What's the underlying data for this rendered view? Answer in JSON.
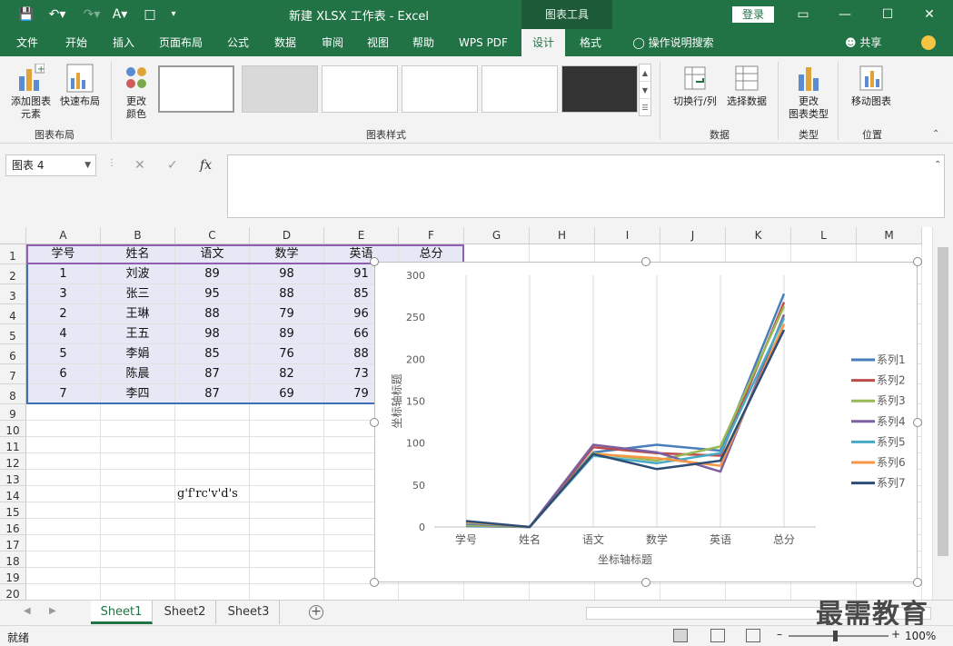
{
  "titlebar": {
    "title": "新建 XLSX 工作表 - Excel",
    "context_tab": "图表工具",
    "login": "登录"
  },
  "tabs": [
    "文件",
    "开始",
    "插入",
    "页面布局",
    "公式",
    "数据",
    "审阅",
    "视图",
    "帮助",
    "WPS PDF",
    "设计",
    "格式"
  ],
  "active_tab": "设计",
  "tell_me": "操作说明搜索",
  "share": "共享",
  "ribbon": {
    "layout_group": {
      "label": "图表布局",
      "add_element": "添加图表\n元素",
      "quick_layout": "快速布局"
    },
    "change_colors": "更改\n颜色",
    "styles_group_label": "图表样式",
    "data_group": {
      "label": "数据",
      "switch_row_col": "切换行/列",
      "select_data": "选择数据"
    },
    "type_group": {
      "label": "类型",
      "change_type": "更改\n图表类型"
    },
    "location_group": {
      "label": "位置",
      "move_chart": "移动图表"
    }
  },
  "formula_bar": {
    "name_box": "图表 4",
    "fx": "fx",
    "value": ""
  },
  "columns": [
    "A",
    "B",
    "C",
    "D",
    "E",
    "F",
    "G",
    "H",
    "I",
    "J",
    "K",
    "L",
    "M"
  ],
  "rows": [
    "1",
    "2",
    "3",
    "4",
    "5",
    "6",
    "7",
    "8",
    "9",
    "10",
    "11",
    "12",
    "13",
    "14",
    "15",
    "16",
    "17",
    "18",
    "19",
    "20"
  ],
  "table": {
    "headers": [
      "学号",
      "姓名",
      "语文",
      "数学",
      "英语",
      "总分"
    ],
    "rows": [
      [
        "1",
        "刘波",
        "89",
        "98",
        "91"
      ],
      [
        "3",
        "张三",
        "95",
        "88",
        "85"
      ],
      [
        "2",
        "王琳",
        "88",
        "79",
        "96"
      ],
      [
        "4",
        "王五",
        "98",
        "89",
        "66"
      ],
      [
        "5",
        "李娟",
        "85",
        "76",
        "88"
      ],
      [
        "6",
        "陈晨",
        "87",
        "82",
        "73"
      ],
      [
        "7",
        "李四",
        "87",
        "69",
        "79"
      ]
    ]
  },
  "stray_cell_text": "g'f'rc'v'd's",
  "chart_data": {
    "type": "line",
    "categories": [
      "学号",
      "姓名",
      "语文",
      "数学",
      "英语",
      "总分"
    ],
    "xlabel": "坐标轴标题",
    "ylabel": "坐标轴标题",
    "ylim": [
      0,
      300
    ],
    "yticks": [
      0,
      50,
      100,
      150,
      200,
      250,
      300
    ],
    "grid": "vertical category lines",
    "legend_position": "right",
    "series": [
      {
        "name": "系列1",
        "color": "#4a7ebb",
        "values": [
          1,
          0,
          89,
          98,
          91,
          278
        ]
      },
      {
        "name": "系列2",
        "color": "#be4b48",
        "values": [
          3,
          0,
          95,
          88,
          85,
          268
        ]
      },
      {
        "name": "系列3",
        "color": "#98b954",
        "values": [
          2,
          0,
          88,
          79,
          96,
          263
        ]
      },
      {
        "name": "系列4",
        "color": "#7d60a0",
        "values": [
          4,
          0,
          98,
          89,
          66,
          253
        ]
      },
      {
        "name": "系列5",
        "color": "#46aac5",
        "values": [
          5,
          0,
          85,
          76,
          88,
          249
        ]
      },
      {
        "name": "系列6",
        "color": "#f79646",
        "values": [
          6,
          0,
          87,
          82,
          73,
          242
        ]
      },
      {
        "name": "系列7",
        "color": "#2c4d75",
        "values": [
          7,
          0,
          87,
          69,
          79,
          235
        ]
      }
    ]
  },
  "sheets": [
    "Sheet1",
    "Sheet2",
    "Sheet3"
  ],
  "active_sheet": "Sheet1",
  "watermark": "最需教育",
  "status": {
    "text": "就绪",
    "zoom": "100%"
  }
}
